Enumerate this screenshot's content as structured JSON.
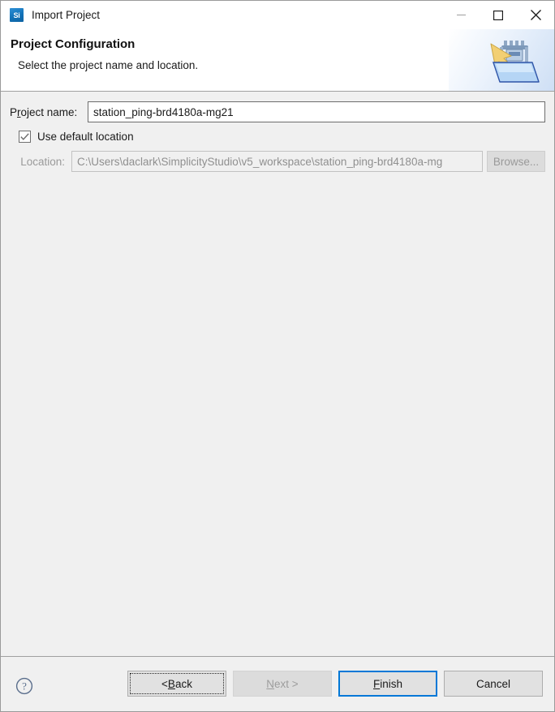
{
  "window": {
    "title": "Import Project",
    "app_icon_label": "Si",
    "controls": {
      "minimize": "minimize-icon",
      "maximize": "maximize-icon",
      "close": "close-icon"
    }
  },
  "header": {
    "title": "Project Configuration",
    "subtitle": "Select the project name and location.",
    "banner_icon": "import-project-folder-icon"
  },
  "form": {
    "project_name": {
      "label_pre": "P",
      "label_mnemonic": "r",
      "label_post": "oject name:",
      "value": "station_ping-brd4180a-mg21",
      "placeholder": ""
    },
    "use_default_location": {
      "label": "Use default location",
      "checked": true
    },
    "location": {
      "label": "Location:",
      "value": "C:\\Users\\daclark\\SimplicityStudio\\v5_workspace\\station_ping-brd4180a-mg",
      "disabled": true
    },
    "browse": {
      "label": "Browse...",
      "disabled": true
    }
  },
  "footer": {
    "help_icon": "help-question-icon",
    "buttons": {
      "back": {
        "pre": "< ",
        "mnemonic": "B",
        "post": "ack"
      },
      "next": {
        "pre": "",
        "mnemonic": "N",
        "post": "ext >",
        "disabled": true
      },
      "finish": {
        "pre": "",
        "mnemonic": "F",
        "post": "inish",
        "default": true
      },
      "cancel": {
        "label": "Cancel"
      }
    }
  },
  "colors": {
    "accent": "#0078d7",
    "window_bg": "#f0f0f0",
    "header_bg": "#ffffff",
    "disabled_text": "#9a9a9a",
    "app_icon": "#1272b8"
  }
}
